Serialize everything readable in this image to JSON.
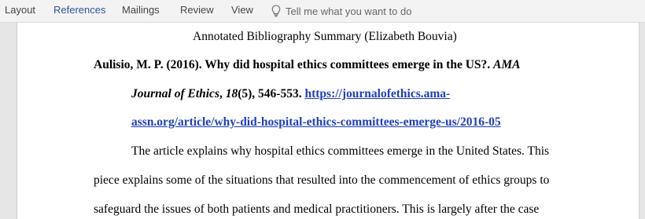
{
  "ribbon": {
    "tabs": [
      "Layout",
      "References",
      "Mailings",
      "Review",
      "View"
    ],
    "active_tab": "References",
    "tell_me": "Tell me what you want to do",
    "accent_color": "#2b579a"
  },
  "document": {
    "title": "Annotated Bibliography Summary (Elizabeth Bouvia)",
    "citation": {
      "authors_title": "Aulisio, M. P. (2016). Why did hospital ethics committees emerge in the US?.",
      "journal_part1": "AMA",
      "journal_part2": "Journal of Ethics",
      "sep1": ",",
      "volume": "18",
      "issue_pages": "(5), 546-553.",
      "url_part1": "https://journalofethics.ama-",
      "url_part2": "assn.org/article/why-did-hospital-ethics-committees-emerge-us/2016-05"
    },
    "body_lines": [
      "The article explains why hospital ethics committees emerge in the United States. This",
      "piece explains some of the situations that resulted into the commencement of ethics groups to",
      "safeguard the issues of both patients and medical practitioners. This is largely after the case"
    ]
  }
}
